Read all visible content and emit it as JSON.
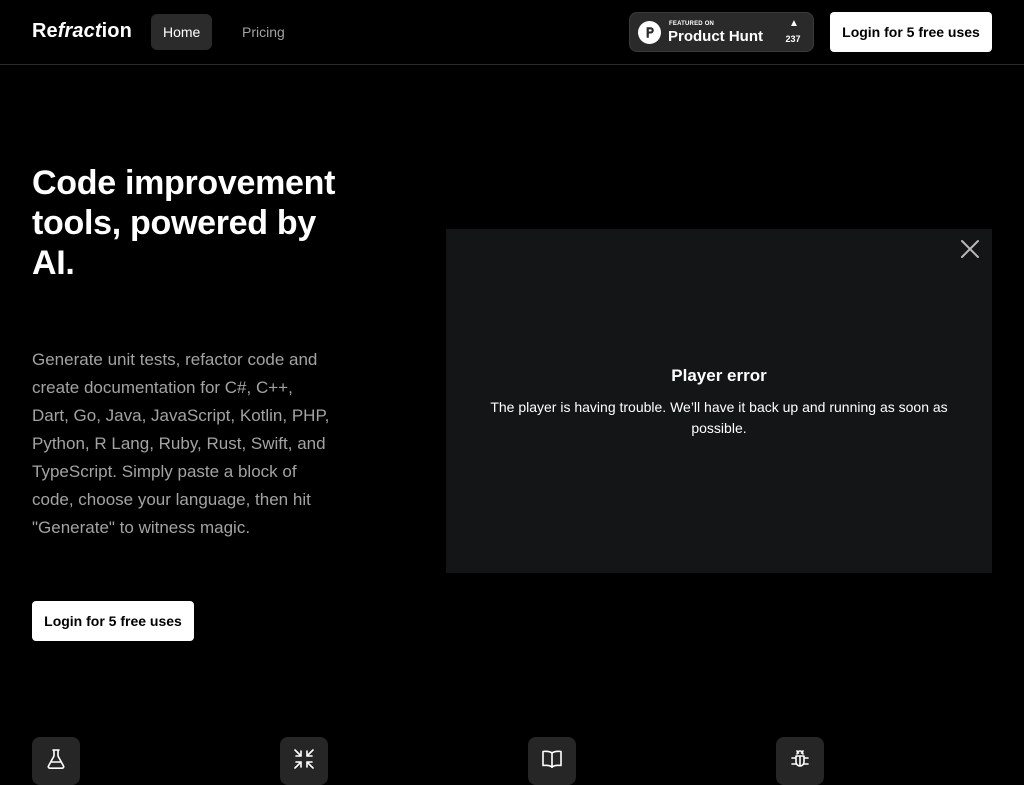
{
  "header": {
    "logo": {
      "prefix": "Re",
      "italic": "fract",
      "suffix": "ion"
    },
    "nav": [
      {
        "label": "Home",
        "active": true
      },
      {
        "label": "Pricing",
        "active": false
      }
    ],
    "product_hunt": {
      "small_text": "FEATURED ON",
      "big_text": "Product Hunt",
      "arrow": "▲",
      "count": "237"
    },
    "login_label": "Login for 5 free uses"
  },
  "hero": {
    "title": "Code improvement tools, powered by AI.",
    "description": "Generate unit tests, refactor code and create documentation for C#, C++, Dart, Go, Java, JavaScript, Kotlin, PHP, Python, R Lang, Ruby, Rust, Swift, and TypeScript. Simply paste a block of code, choose your language, then hit \"Generate\" to witness magic.",
    "login_label": "Login for 5 free uses"
  },
  "player": {
    "error_title": "Player error",
    "error_message": "The player is having trouble. We’ll have it back up and running as soon as possible."
  },
  "features": {
    "icons": [
      "flask-icon",
      "compress-arrows-icon",
      "book-icon",
      "bug-icon"
    ]
  },
  "colors": {
    "background": "#000000",
    "player_background": "#141517",
    "muted_text": "#a3a3a3",
    "button_bg": "#ffffff",
    "icon_tile": "#262626"
  }
}
